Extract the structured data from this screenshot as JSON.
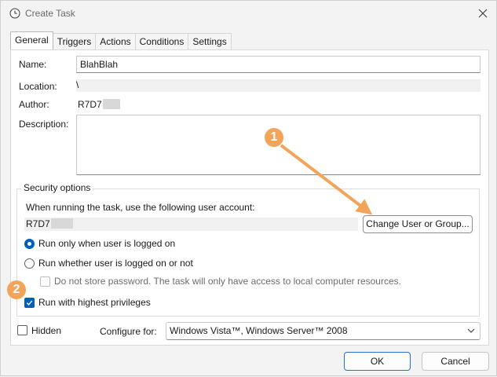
{
  "window": {
    "title": "Create Task",
    "icon": "clock-icon",
    "close_icon": "close-icon"
  },
  "tabs": [
    {
      "label": "General",
      "active": true
    },
    {
      "label": "Triggers",
      "active": false
    },
    {
      "label": "Actions",
      "active": false
    },
    {
      "label": "Conditions",
      "active": false
    },
    {
      "label": "Settings",
      "active": false
    }
  ],
  "general": {
    "name_label": "Name:",
    "name_value": "BlahBlah",
    "location_label": "Location:",
    "location_value": "\\",
    "author_label": "Author:",
    "author_value": "R7D7",
    "description_label": "Description:",
    "description_value": ""
  },
  "security": {
    "legend": "Security options",
    "account_prompt": "When running the task, use the following user account:",
    "account_value": "R7D7",
    "change_button": "Change User or Group...",
    "run_logged_on": "Run only when user is logged on",
    "run_logged_on_selected": true,
    "run_whether": "Run whether user is logged on or not",
    "run_whether_selected": false,
    "no_store_password": "Do not store password.  The task will only have access to local computer resources.",
    "no_store_password_checked": false,
    "highest_privileges": "Run with highest privileges",
    "highest_privileges_checked": true
  },
  "bottom": {
    "hidden_label": "Hidden",
    "hidden_checked": false,
    "configure_label": "Configure for:",
    "configure_value": "Windows Vista™, Windows Server™ 2008"
  },
  "buttons": {
    "ok": "OK",
    "cancel": "Cancel"
  },
  "annotations": {
    "badge_1": "1",
    "badge_2": "2",
    "color": "#f3a45b"
  },
  "colors": {
    "accent": "#005fb8",
    "annotation": "#f3a45b"
  }
}
